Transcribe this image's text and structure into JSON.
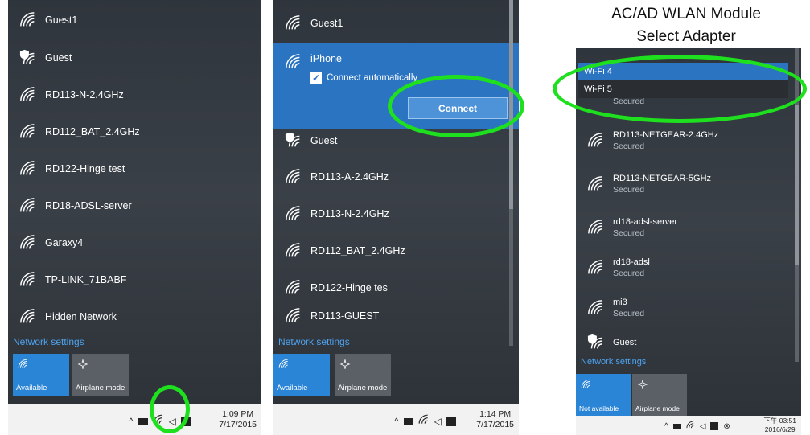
{
  "panel1": {
    "networks": [
      "Guest1",
      "Guest",
      "RD113-N-2.4GHz",
      "RD112_BAT_2.4GHz",
      "RD122-Hinge test",
      "RD18-ADSL-server",
      "Garaxy4",
      "TP-LINK_71BABF",
      "Hidden Network"
    ],
    "network_settings": "Network settings",
    "tile_available": "Available",
    "tile_airplane": "Airplane mode",
    "time": "1:09 PM",
    "date": "7/17/2015"
  },
  "panel2": {
    "networks_top": [
      "Guest1"
    ],
    "selected_network": "iPhone",
    "connect_auto": "Connect automatically",
    "connect_button": "Connect",
    "networks_bottom": [
      "Guest",
      "RD113-A-2.4GHz",
      "RD113-N-2.4GHz",
      "RD112_BAT_2.4GHz",
      "RD122-Hinge tes",
      "RD113-GUEST"
    ],
    "network_settings": "Network settings",
    "tile_available": "Available",
    "tile_airplane": "Airplane mode",
    "time": "1:14 PM",
    "date": "7/17/2015"
  },
  "panel3": {
    "heading_line1": "AC/AD WLAN Module",
    "heading_line2": "Select Adapter",
    "adapters": [
      "Wi-Fi 4",
      "Wi-Fi 5"
    ],
    "partial_status": "Secured",
    "networks": [
      {
        "name": "RD113-NETGEAR-2.4GHz",
        "status": "Secured"
      },
      {
        "name": "RD113-NETGEAR-5GHz",
        "status": "Secured"
      },
      {
        "name": "rd18-adsl-server",
        "status": "Secured"
      },
      {
        "name": "rd18-adsl",
        "status": "Secured"
      },
      {
        "name": "mi3",
        "status": "Secured"
      }
    ],
    "guest": "Guest",
    "network_settings": "Network settings",
    "tile_not_available": "Not available",
    "tile_airplane": "Airplane mode",
    "time": "下午 03:51",
    "date": "2016/6/29"
  },
  "colors": {
    "accent": "#2b74c2",
    "highlight_ring": "#1ee01e"
  }
}
